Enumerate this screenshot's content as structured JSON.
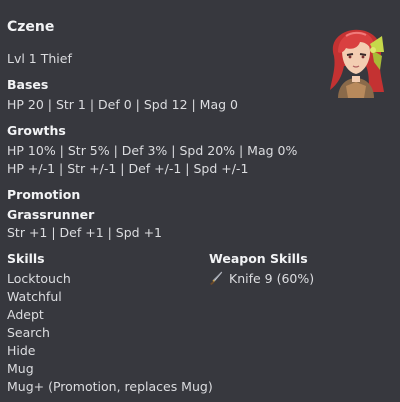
{
  "unit": {
    "name": "Czene",
    "class_line": "Lvl 1 Thief"
  },
  "bases": {
    "heading": "Bases",
    "text": "HP 20 | Str 1 | Def 0 | Spd 12 | Mag 0"
  },
  "growths": {
    "heading": "Growths",
    "text": "HP 10% | Str 5% | Def 3% | Spd 20% | Mag 0%",
    "modifiers": "HP +/-1 | Str +/-1 | Def +/-1 | Spd +/-1"
  },
  "promotion": {
    "heading": "Promotion",
    "class_name": "Grassrunner",
    "bonuses": "Str +1 | Def +1 | Spd +1"
  },
  "skills": {
    "heading": "Skills",
    "items": [
      "Locktouch",
      "Watchful",
      "Adept",
      "Search",
      "Hide",
      "Mug",
      "Mug+ (Promotion, replaces Mug)"
    ]
  },
  "weapon_skills": {
    "heading": "Weapon Skills",
    "items": [
      {
        "icon": "knife-icon",
        "label": "Knife 9 (60%)"
      }
    ]
  },
  "colors": {
    "background": "#37383e",
    "heading": "#f2f3f5",
    "text": "#dcdde0",
    "portrait_hair": "#d23a3a",
    "portrait_bow": "#c6d84a"
  }
}
